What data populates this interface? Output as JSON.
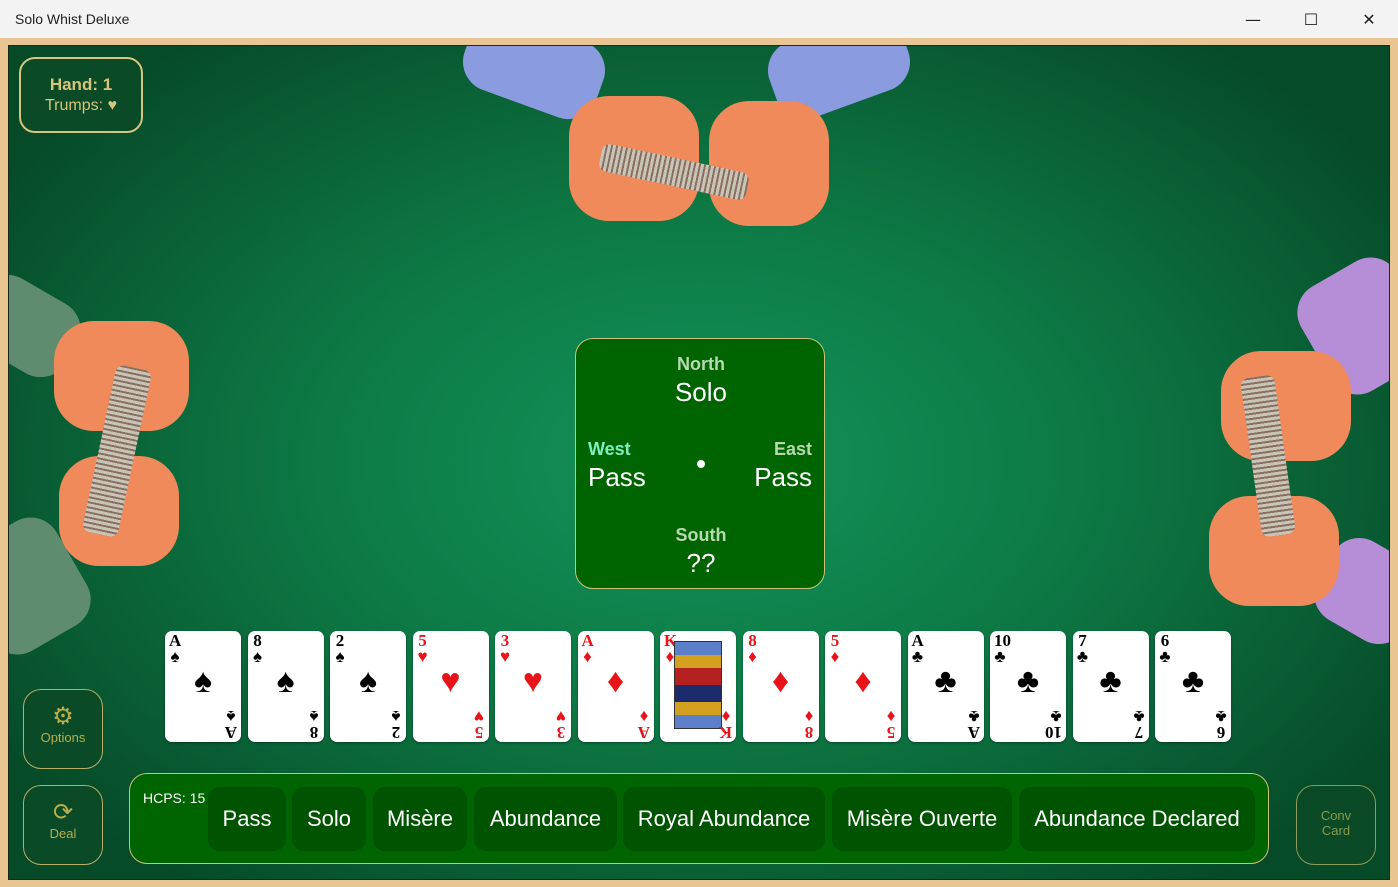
{
  "window": {
    "title": "Solo Whist Deluxe",
    "minimize": "—",
    "maximize": "☐",
    "close": "✕"
  },
  "status": {
    "hand": "Hand: 1",
    "trumps": "Trumps: ♥"
  },
  "bidding": {
    "north": {
      "name": "North",
      "bid": "Solo"
    },
    "west": {
      "name": "West",
      "bid": "Pass",
      "active": true
    },
    "east": {
      "name": "East",
      "bid": "Pass"
    },
    "south": {
      "name": "South",
      "bid": "??"
    }
  },
  "hand_cards": [
    {
      "rank": "A",
      "suit": "♠",
      "color": "black"
    },
    {
      "rank": "8",
      "suit": "♠",
      "color": "black"
    },
    {
      "rank": "2",
      "suit": "♠",
      "color": "black"
    },
    {
      "rank": "5",
      "suit": "♥",
      "color": "red"
    },
    {
      "rank": "3",
      "suit": "♥",
      "color": "red"
    },
    {
      "rank": "A",
      "suit": "♦",
      "color": "red"
    },
    {
      "rank": "K",
      "suit": "♦",
      "color": "red",
      "face": true
    },
    {
      "rank": "8",
      "suit": "♦",
      "color": "red"
    },
    {
      "rank": "5",
      "suit": "♦",
      "color": "red"
    },
    {
      "rank": "A",
      "suit": "♣",
      "color": "black"
    },
    {
      "rank": "10",
      "suit": "♣",
      "color": "black"
    },
    {
      "rank": "7",
      "suit": "♣",
      "color": "black"
    },
    {
      "rank": "6",
      "suit": "♣",
      "color": "black"
    }
  ],
  "side_buttons": {
    "options": {
      "label": "Options",
      "icon": "gear-icon",
      "glyph": "⚙"
    },
    "deal": {
      "label": "Deal",
      "icon": "refresh-icon",
      "glyph": "⟳"
    },
    "conv_card": {
      "label1": "Conv",
      "label2": "Card",
      "disabled": true
    }
  },
  "bid_bar": {
    "hcps": "HCPS: 15",
    "buttons": [
      "Pass",
      "Solo",
      "Misère",
      "Abundance",
      "Royal Abundance",
      "Misère Ouverte",
      "Abundance Declared"
    ]
  },
  "colors": {
    "felt": "#0d7a45",
    "panel": "#006400",
    "gold": "#d6c57c",
    "frame": "#e8c592"
  }
}
